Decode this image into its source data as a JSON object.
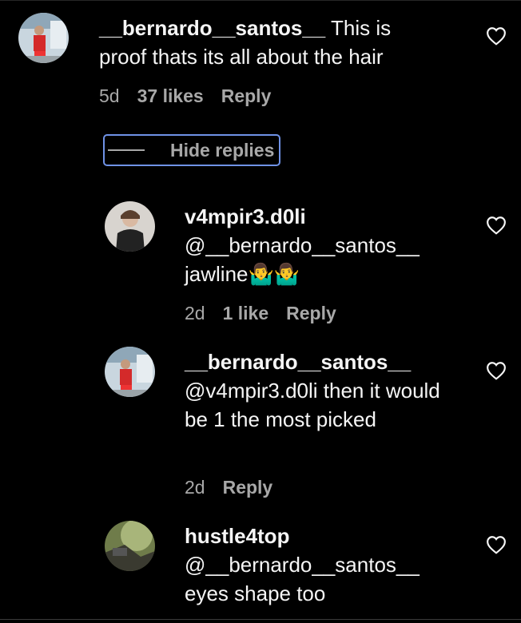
{
  "comments": [
    {
      "username": "__bernardo__santos__",
      "text": "This is proof thats its all about the hair",
      "time": "5d",
      "likes": "37 likes",
      "reply": "Reply"
    },
    {
      "username": "v4mpir3.d0li",
      "text": "@__bernardo__santos__ jawline🤷‍♂️🤷‍♂️",
      "time": "2d",
      "likes": "1 like",
      "reply": "Reply"
    },
    {
      "username": "__bernardo__santos__",
      "text": "@v4mpir3.d0li then it would be 1 the most picked",
      "time": "2d",
      "likes": "",
      "reply": "Reply"
    },
    {
      "username": "hustle4top",
      "text": "@__bernardo__santos__ eyes shape too"
    }
  ],
  "hide_replies_label": "Hide replies",
  "icons": {
    "like": "heart-outline-icon"
  },
  "colors": {
    "background": "#000000",
    "text": "#f5f5f5",
    "secondary": "#a8a8a8",
    "focus": "#6f92e6"
  }
}
